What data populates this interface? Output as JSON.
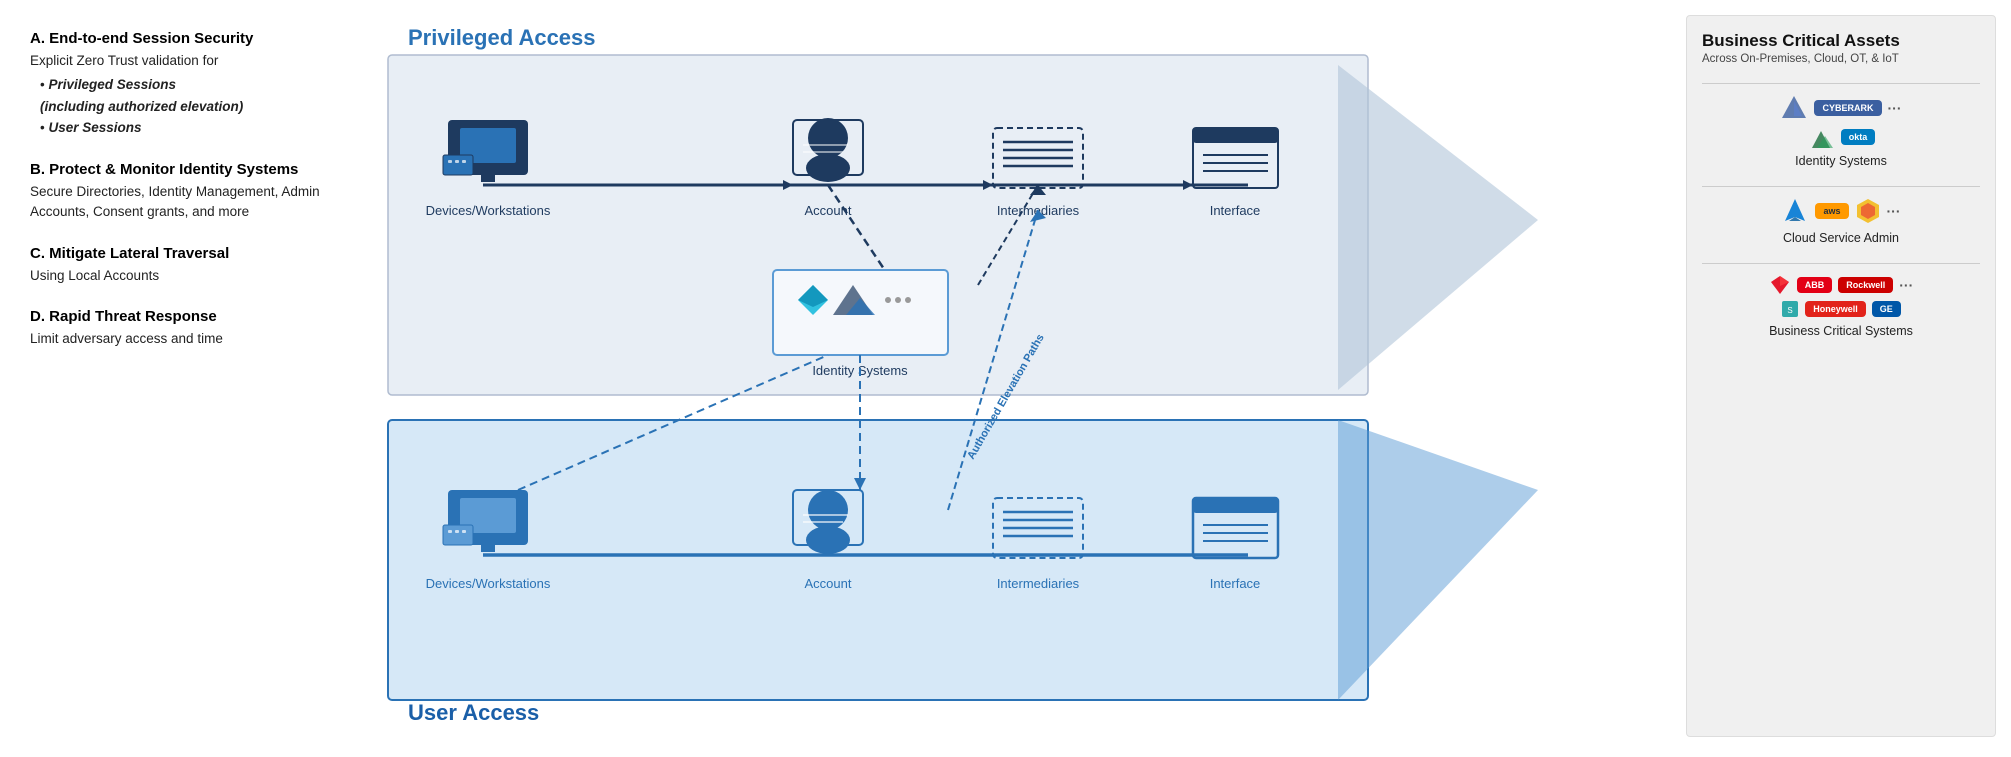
{
  "left": {
    "sections": [
      {
        "id": "A",
        "title": "A. End-to-end Session Security",
        "body": "Explicit Zero Trust validation for",
        "bullets": [
          "Privileged Sessions (including authorized elevation)",
          "User Sessions"
        ]
      },
      {
        "id": "B",
        "title": "B. Protect & Monitor Identity Systems",
        "body": "Secure Directories, Identity Management, Admin Accounts, Consent grants, and more"
      },
      {
        "id": "C",
        "title": "C. Mitigate Lateral Traversal",
        "body": "Using Local Accounts"
      },
      {
        "id": "D",
        "title": "D. Rapid Threat Response",
        "body": "Limit adversary access and time"
      }
    ]
  },
  "diagram": {
    "privileged_access_label": "Privileged Access",
    "user_access_label": "User Access",
    "nodes": {
      "privileged_row": [
        "Devices/Workstations",
        "Account",
        "Intermediaries",
        "Interface"
      ],
      "user_row": [
        "Devices/Workstations",
        "Account",
        "Intermediaries",
        "Interface"
      ],
      "identity_systems_label": "Identity Systems",
      "authorized_elevation_label": "Authorized Elevation Paths"
    }
  },
  "right": {
    "title": "Business Critical Assets",
    "subtitle": "Across On-Premises, Cloud, OT, & IoT",
    "sections": [
      {
        "id": "identity",
        "label": "Identity Systems",
        "logos": [
          "Ping",
          "CyberArk",
          "SailPoint",
          "okta",
          "..."
        ]
      },
      {
        "id": "cloud",
        "label": "Cloud Service Admin",
        "logos": [
          "Azure",
          "aws",
          "GCP",
          "..."
        ]
      },
      {
        "id": "bcs",
        "label": "Business Critical Systems",
        "logos": [
          "ABB",
          "Rockwell",
          "Siemens",
          "Honeywell",
          "GE",
          "..."
        ]
      }
    ]
  }
}
